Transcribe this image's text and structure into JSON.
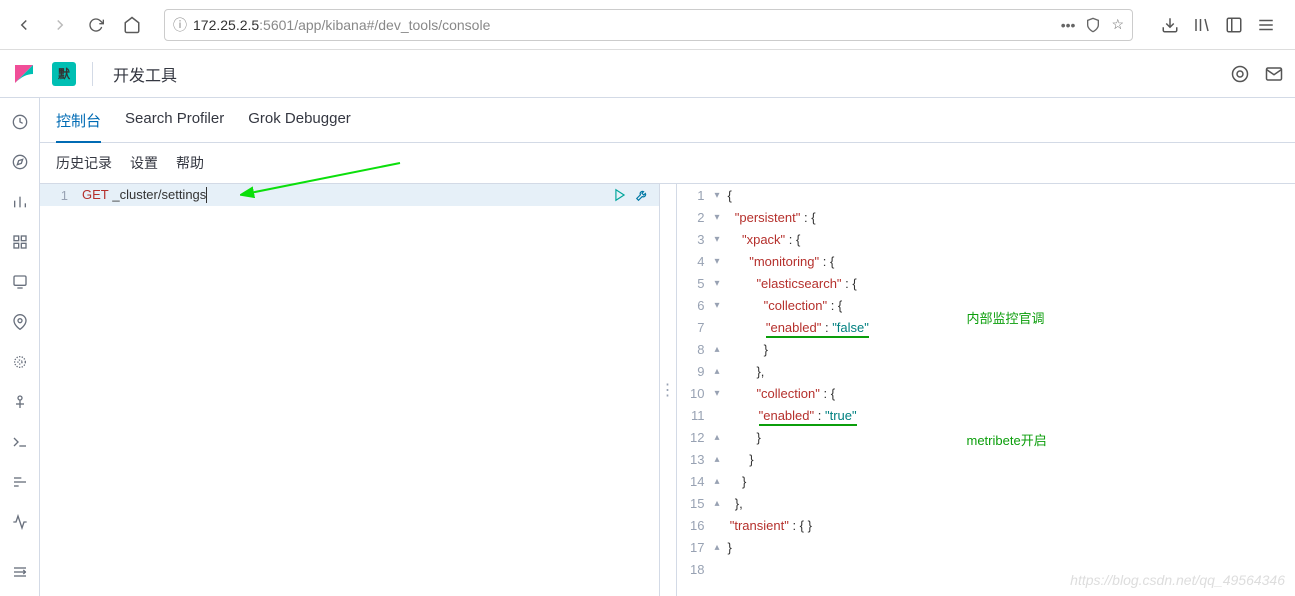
{
  "browser": {
    "url_prefix": "172.25.2.5",
    "url_suffix": ":5601/app/kibana#/dev_tools/console"
  },
  "header": {
    "badge": "默",
    "title": "开发工具"
  },
  "tabs": {
    "console": "控制台",
    "profiler": "Search Profiler",
    "grok": "Grok Debugger"
  },
  "toolbar": {
    "history": "历史记录",
    "settings": "设置",
    "help": "帮助"
  },
  "editor": {
    "line1_num": "1",
    "method": "GET",
    "path": " _cluster/settings"
  },
  "output_lines": [
    "1",
    "2",
    "3",
    "4",
    "5",
    "6",
    "7",
    "8",
    "9",
    "10",
    "11",
    "12",
    "13",
    "14",
    "15",
    "16",
    "17",
    "18"
  ],
  "json": {
    "persistent": "\"persistent\"",
    "xpack": "\"xpack\"",
    "monitoring": "\"monitoring\"",
    "elasticsearch": "\"elasticsearch\"",
    "collection": "\"collection\"",
    "enabled": "\"enabled\"",
    "false": "\"false\"",
    "true": "\"true\"",
    "transient": "\"transient\""
  },
  "annotations": {
    "a1": "内部监控官调",
    "a2": "metribete开启"
  },
  "watermark": "https://blog.csdn.net/qq_49564346"
}
